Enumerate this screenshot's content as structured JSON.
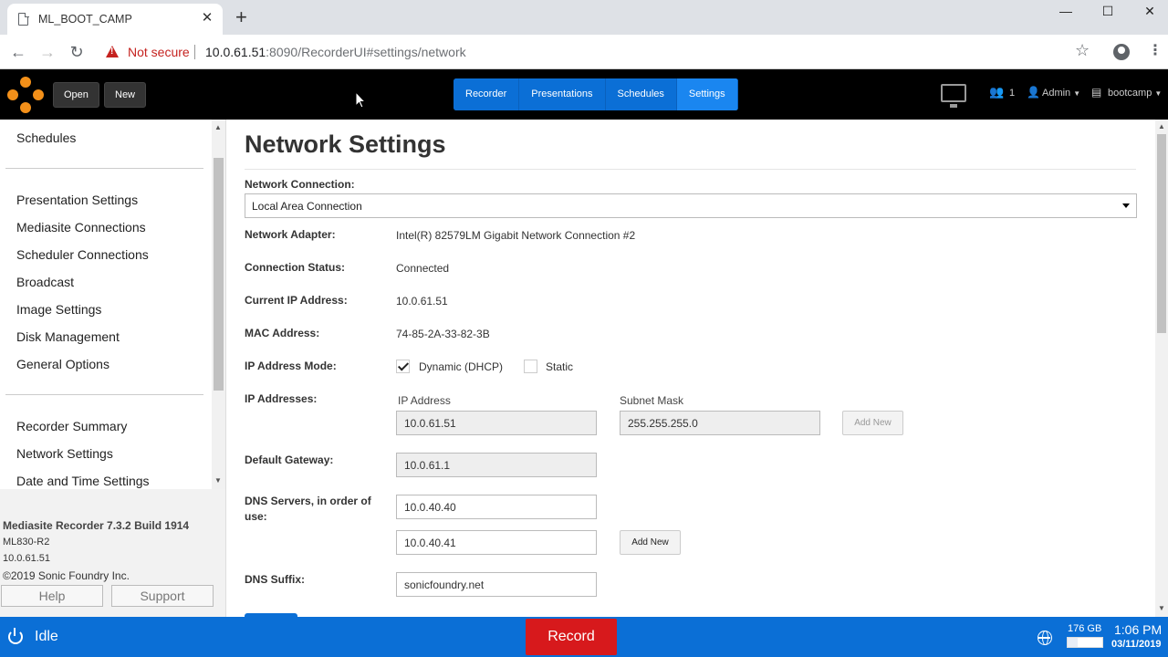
{
  "browser": {
    "tab_title": "ML_BOOT_CAMP",
    "tab_close": "✕",
    "new_tab": "+",
    "not_secure": "Not secure",
    "url_host": "10.0.61.51",
    "url_path": ":8090/RecorderUI#settings/network",
    "window_controls": [
      "—",
      "☐",
      "✕"
    ]
  },
  "header": {
    "open_label": "Open",
    "new_label": "New",
    "nav": [
      {
        "label": "Recorder",
        "active": false
      },
      {
        "label": "Presentations",
        "active": false
      },
      {
        "label": "Schedules",
        "active": false
      },
      {
        "label": "Settings",
        "active": true
      }
    ],
    "viewer_count": "1",
    "user": "Admin",
    "profile": "bootcamp"
  },
  "sidebar": {
    "items_top": [
      "Schedules"
    ],
    "items_mid": [
      "Presentation Settings",
      "Mediasite Connections",
      "Scheduler Connections",
      "Broadcast",
      "Image Settings",
      "Disk Management",
      "General Options"
    ],
    "items_bottom": [
      "Recorder Summary",
      "Network Settings",
      "Date and Time Settings"
    ],
    "footer": {
      "build": "Mediasite Recorder 7.3.2 Build 1914",
      "model": "ML830-R2",
      "ip": "10.0.61.51",
      "copyright": "©2019 Sonic Foundry Inc.",
      "help": "Help",
      "support": "Support"
    }
  },
  "main": {
    "title": "Network Settings",
    "network_connection_label": "Network Connection:",
    "network_connection_value": "Local Area Connection",
    "adapter_label": "Network Adapter:",
    "adapter_value": "Intel(R) 82579LM Gigabit Network Connection #2",
    "status_label": "Connection Status:",
    "status_value": "Connected",
    "current_ip_label": "Current IP Address:",
    "current_ip_value": "10.0.61.51",
    "mac_label": "MAC Address:",
    "mac_value": "74-85-2A-33-82-3B",
    "ip_mode_label": "IP Address Mode:",
    "ip_mode_dhcp": "Dynamic (DHCP)",
    "ip_mode_static": "Static",
    "ip_addresses_label": "IP Addresses:",
    "ip_col_header": "IP Address",
    "mask_col_header": "Subnet Mask",
    "ip_value": "10.0.61.51",
    "mask_value": "255.255.255.0",
    "add_new": "Add New",
    "gateway_label": "Default Gateway:",
    "gateway_value": "10.0.61.1",
    "dns_label": "DNS Servers, in order of use:",
    "dns1": "10.0.40.40",
    "dns2": "10.0.40.41",
    "suffix_label": "DNS Suffix:",
    "suffix_value": "sonicfoundry.net"
  },
  "statusbar": {
    "state": "Idle",
    "record": "Record",
    "disk": "176 GB",
    "disk_used_fraction": 0.3,
    "time": "1:06 PM",
    "date": "03/11/2019"
  }
}
